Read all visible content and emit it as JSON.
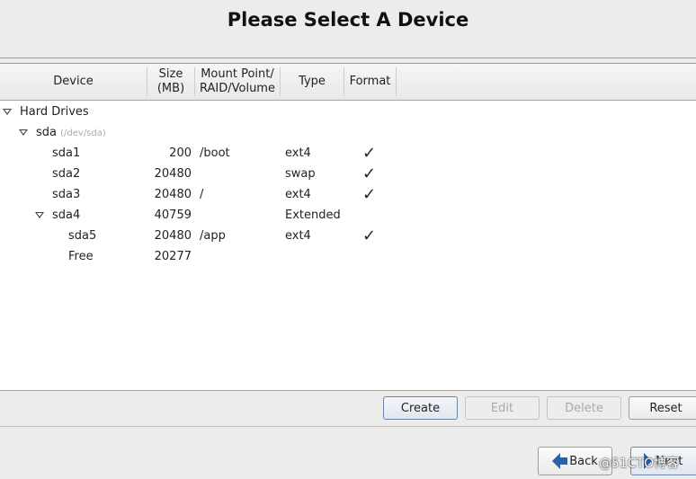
{
  "title": "Please Select A Device",
  "columns": [
    "Device",
    "Size\n(MB)",
    "Mount Point/\nRAID/Volume",
    "Type",
    "Format"
  ],
  "column_labels": {
    "device": "Device",
    "size_1": "Size",
    "size_2": "(MB)",
    "mount_1": "Mount Point/",
    "mount_2": "RAID/Volume",
    "type": "Type",
    "format": "Format"
  },
  "tree": {
    "group": "Hard Drives",
    "disk": {
      "name": "sda",
      "path": "(/dev/sda)"
    },
    "rows": [
      {
        "device": "sda1",
        "size": "200",
        "mount": "/boot",
        "type": "ext4",
        "format": "✓"
      },
      {
        "device": "sda2",
        "size": "20480",
        "mount": "",
        "type": "swap",
        "format": "✓"
      },
      {
        "device": "sda3",
        "size": "20480",
        "mount": "/",
        "type": "ext4",
        "format": "✓"
      },
      {
        "device": "sda4",
        "size": "40759",
        "mount": "",
        "type": "Extended",
        "format": ""
      },
      {
        "device": "sda5",
        "size": "20480",
        "mount": "/app",
        "type": "ext4",
        "format": "✓"
      },
      {
        "device": "Free",
        "size": "20277",
        "mount": "",
        "type": "",
        "format": ""
      }
    ]
  },
  "actions": {
    "create": "Create",
    "edit": "Edit",
    "delete": "Delete",
    "reset": "Reset"
  },
  "nav": {
    "back": "Back",
    "next": "Next"
  },
  "watermark": "@51CTO博客",
  "colors": {
    "accent": "#2b62a8",
    "background": "#edeceb"
  }
}
